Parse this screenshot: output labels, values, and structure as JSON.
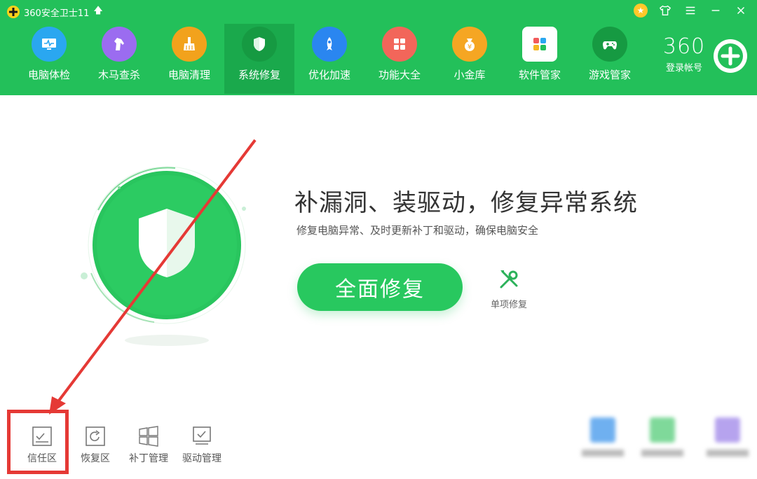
{
  "app": {
    "title": "360安全卫士11"
  },
  "nav": [
    {
      "label": "电脑体检",
      "icon": "monitor-icon",
      "color": "#2aa7f0"
    },
    {
      "label": "木马查杀",
      "icon": "horse-icon",
      "color": "#9b6cf0"
    },
    {
      "label": "电脑清理",
      "icon": "broom-icon",
      "color": "#f2a21c"
    },
    {
      "label": "系统修复",
      "icon": "shield-icon",
      "color": "#1aa94c",
      "active": true
    },
    {
      "label": "优化加速",
      "icon": "rocket-icon",
      "color": "#2a86f0"
    },
    {
      "label": "功能大全",
      "icon": "grid-icon",
      "color": "#f2665a"
    },
    {
      "label": "小金库",
      "icon": "coin-bag-icon",
      "color": "#f5a623"
    },
    {
      "label": "软件管家",
      "icon": "apps-icon",
      "color": "#ffffff"
    },
    {
      "label": "游戏管家",
      "icon": "gamepad-icon",
      "color": "#169a42"
    }
  ],
  "account": {
    "logo": "360",
    "label": "登录帐号"
  },
  "main": {
    "headline": "补漏洞、装驱动，修复异常系统",
    "subline": "修复电脑异常、及时更新补丁和驱动，确保电脑安全",
    "fix_button": "全面修复",
    "single_fix": "单项修复"
  },
  "bottom_tools": [
    {
      "label": "信任区",
      "icon": "trust-zone-icon"
    },
    {
      "label": "恢复区",
      "icon": "restore-icon"
    },
    {
      "label": "补丁管理",
      "icon": "windows-icon"
    },
    {
      "label": "驱动管理",
      "icon": "driver-icon"
    }
  ],
  "colors": {
    "brand_green": "#23c05a",
    "highlight_red": "#e53935"
  }
}
